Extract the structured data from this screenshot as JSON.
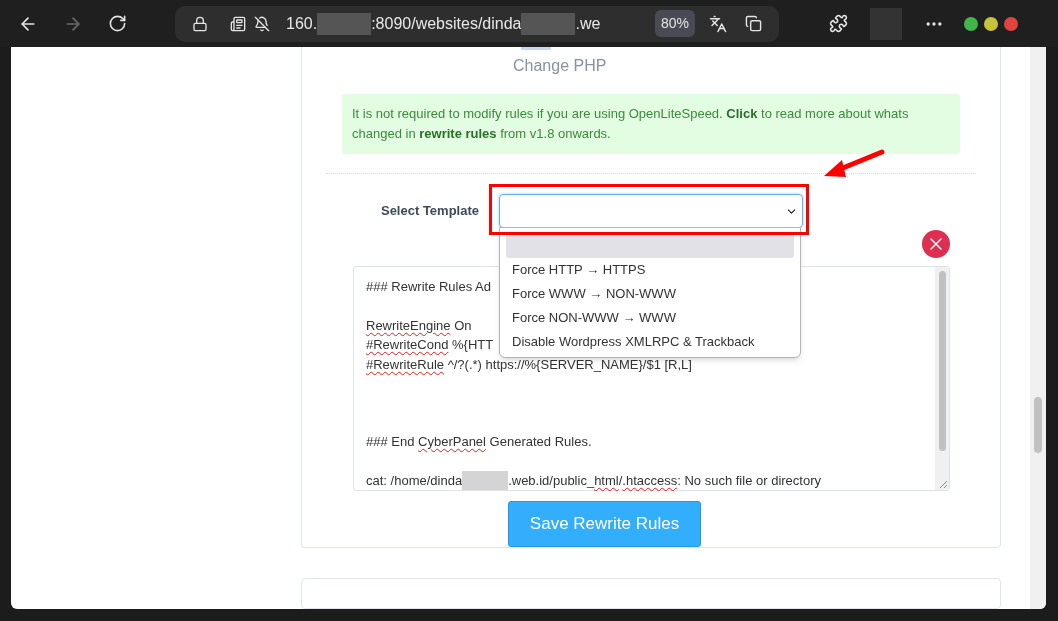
{
  "browser": {
    "forward_disabled": true,
    "url_parts": [
      {
        "kind": "text",
        "text": "160."
      },
      {
        "kind": "redacted"
      },
      {
        "kind": "text",
        "text": ":8090/websites/dinda"
      },
      {
        "kind": "redacted"
      },
      {
        "kind": "text",
        "text": ".we"
      }
    ],
    "zoom": "80%"
  },
  "page": {
    "heading": "Change PHP",
    "notice": "It is not required to modify rules if you are using OpenLiteSpeed. **Click** to read more about whats changed in **rewrite rules** from v1.8 onwards.",
    "template_label": "Select Template",
    "template_options": [
      {
        "selected": true
      },
      {
        "label": "Force HTTP → HTTPS",
        "selected": false
      },
      {
        "label": "Force WWW → NON-WWW",
        "selected": false
      },
      {
        "label": "Force NON-WWW → WWW",
        "selected": false
      },
      {
        "label": "Disable Wordpress XMLRPC & Trackback",
        "selected": false
      }
    ],
    "rules_lines": [
      {
        "kind": "text",
        "segments": [
          {
            "kind": "word",
            "text": "### Rewrite Rules Ad"
          }
        ]
      },
      {
        "kind": "blank"
      },
      {
        "kind": "text",
        "segments": [
          {
            "kind": "misspelled",
            "text": "RewriteEngine"
          },
          {
            "kind": "word",
            "text": " On"
          }
        ]
      },
      {
        "kind": "text",
        "segments": [
          {
            "kind": "misspelled",
            "text": "#RewriteCond"
          },
          {
            "kind": "word",
            "text": " %{HTT"
          }
        ]
      },
      {
        "kind": "text",
        "segments": [
          {
            "kind": "misspelled",
            "text": "#RewriteRule"
          },
          {
            "kind": "word",
            "text": " ^/?(.*) https://%{SERVER_NAME}/$1 [R,L]"
          }
        ]
      },
      {
        "kind": "blank"
      },
      {
        "kind": "blank"
      },
      {
        "kind": "blank"
      },
      {
        "kind": "text",
        "segments": [
          {
            "kind": "word",
            "text": "### End "
          },
          {
            "kind": "misspelled",
            "text": "CyberPanel"
          },
          {
            "kind": "word",
            "text": " Generated Rules."
          }
        ]
      },
      {
        "kind": "blank"
      },
      {
        "kind": "text",
        "segments": [
          {
            "kind": "word",
            "text": "cat: /home/dinda"
          },
          {
            "kind": "redacted"
          },
          {
            "kind": "word",
            "text": ".web.id/public_"
          },
          {
            "kind": "misspelled",
            "text": "html"
          },
          {
            "kind": "word",
            "text": "/"
          },
          {
            "kind": "misspelled",
            "text": ".htaccess"
          },
          {
            "kind": "word",
            "text": ": No such file or directory"
          }
        ]
      }
    ],
    "save_button": "Save Rewrite Rules"
  }
}
